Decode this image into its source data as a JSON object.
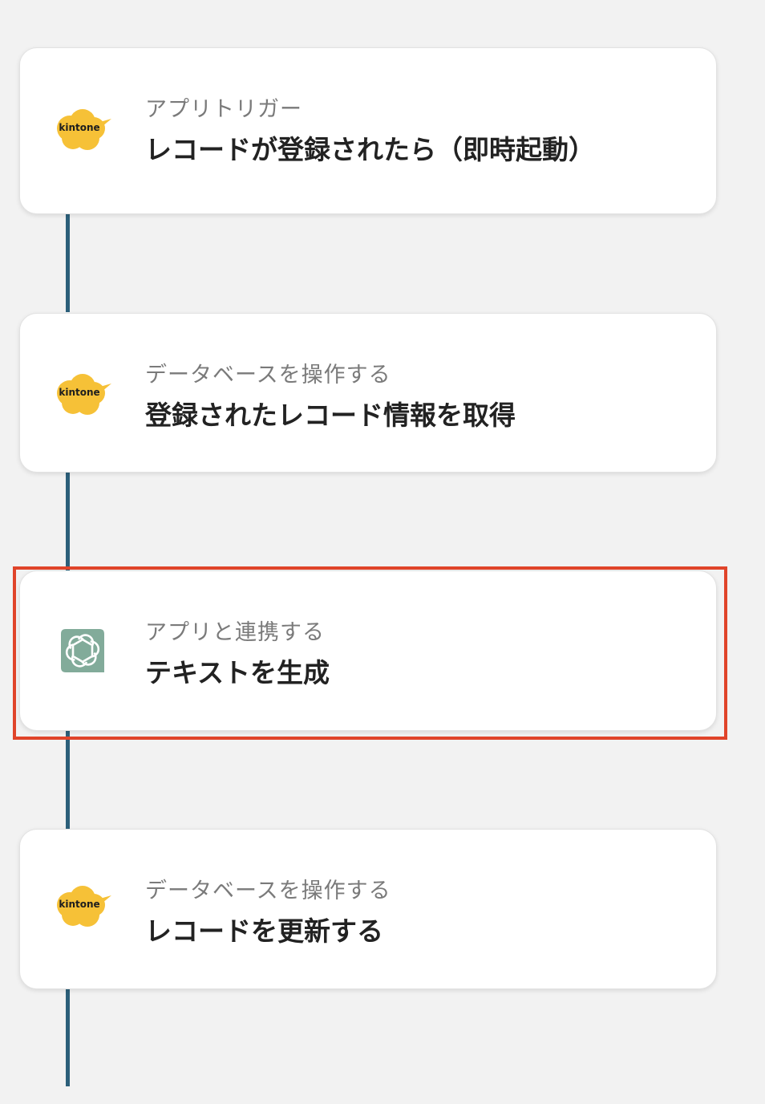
{
  "steps": [
    {
      "label": "アプリトリガー",
      "title": "レコードが登録されたら（即時起動）",
      "icon": "kintone-icon",
      "icon_text": "kintone"
    },
    {
      "label": "データベースを操作する",
      "title": "登録されたレコード情報を取得",
      "icon": "kintone-icon",
      "icon_text": "kintone"
    },
    {
      "label": "アプリと連携する",
      "title": "テキストを生成",
      "icon": "openai-icon",
      "highlighted": true
    },
    {
      "label": "データベースを操作する",
      "title": "レコードを更新する",
      "icon": "kintone-icon",
      "icon_text": "kintone"
    }
  ],
  "colors": {
    "background": "#f2f2f2",
    "connector": "#2c5f7a",
    "highlight": "#e0442a",
    "kintone": "#f6c137",
    "openai": "#82ab9a"
  }
}
